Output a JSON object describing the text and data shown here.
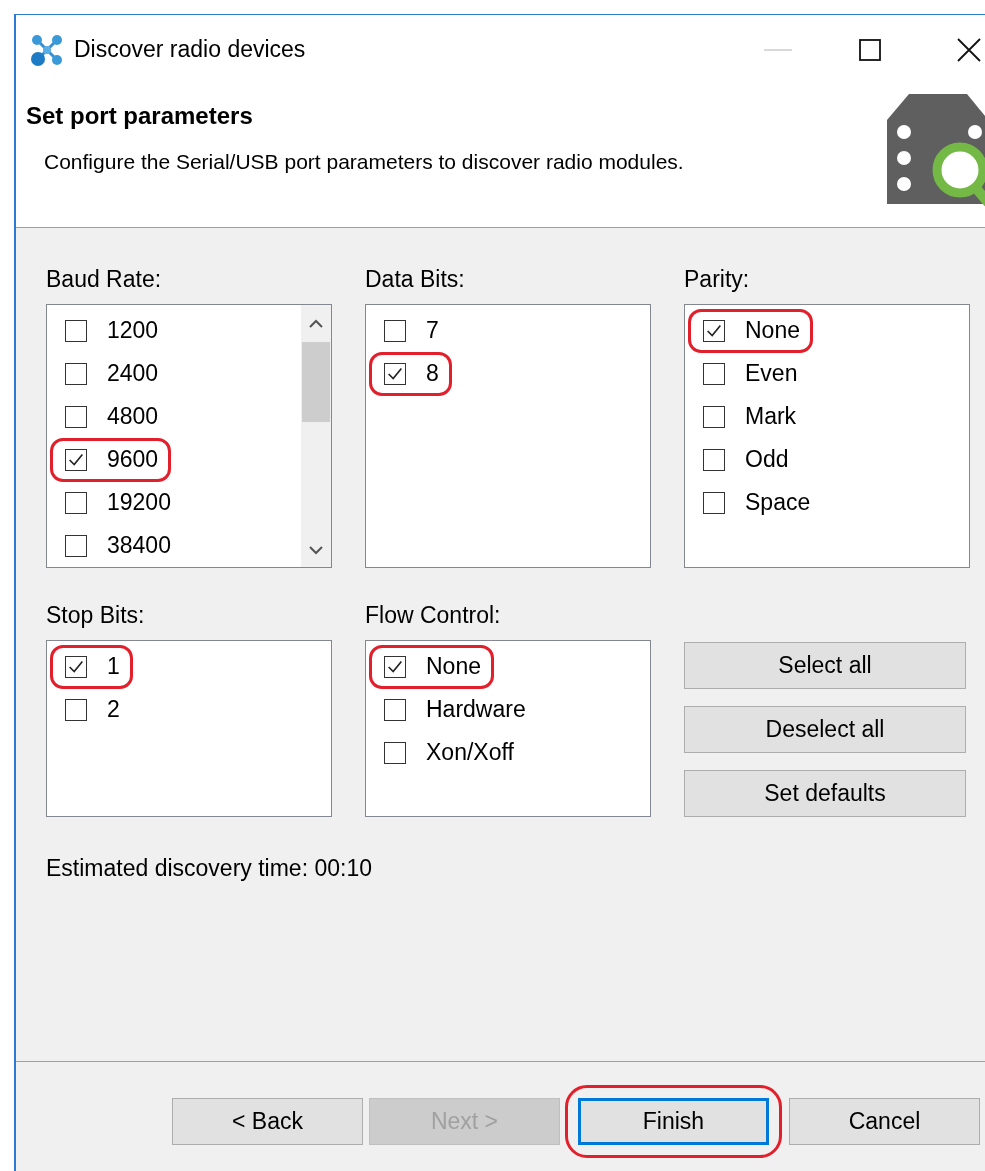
{
  "window": {
    "title": "Discover radio devices"
  },
  "header": {
    "title": "Set port parameters",
    "description": "Configure the Serial/USB port parameters to discover radio modules."
  },
  "groups": [
    {
      "label": "Baud Rate:",
      "scrollable": true,
      "items": [
        {
          "label": "1200",
          "checked": false,
          "highlighted": false
        },
        {
          "label": "2400",
          "checked": false,
          "highlighted": false
        },
        {
          "label": "4800",
          "checked": false,
          "highlighted": false
        },
        {
          "label": "9600",
          "checked": true,
          "highlighted": true
        },
        {
          "label": "19200",
          "checked": false,
          "highlighted": false
        },
        {
          "label": "38400",
          "checked": false,
          "highlighted": false
        }
      ]
    },
    {
      "label": "Data Bits:",
      "scrollable": false,
      "items": [
        {
          "label": "7",
          "checked": false,
          "highlighted": false
        },
        {
          "label": "8",
          "checked": true,
          "highlighted": true
        }
      ]
    },
    {
      "label": "Parity:",
      "scrollable": false,
      "items": [
        {
          "label": "None",
          "checked": true,
          "highlighted": true
        },
        {
          "label": "Even",
          "checked": false,
          "highlighted": false
        },
        {
          "label": "Mark",
          "checked": false,
          "highlighted": false
        },
        {
          "label": "Odd",
          "checked": false,
          "highlighted": false
        },
        {
          "label": "Space",
          "checked": false,
          "highlighted": false
        }
      ]
    },
    {
      "label": "Stop Bits:",
      "scrollable": false,
      "items": [
        {
          "label": "1",
          "checked": true,
          "highlighted": true
        },
        {
          "label": "2",
          "checked": false,
          "highlighted": false
        }
      ]
    },
    {
      "label": "Flow Control:",
      "scrollable": false,
      "items": [
        {
          "label": "None",
          "checked": true,
          "highlighted": true
        },
        {
          "label": "Hardware",
          "checked": false,
          "highlighted": false
        },
        {
          "label": "Xon/Xoff",
          "checked": false,
          "highlighted": false
        }
      ]
    }
  ],
  "side_buttons": [
    "Select all",
    "Deselect all",
    "Set defaults"
  ],
  "estimate": "Estimated discovery time: 00:10",
  "footer_buttons": [
    {
      "label": "< Back",
      "disabled": false,
      "default": false,
      "highlighted": false
    },
    {
      "label": "Next >",
      "disabled": true,
      "default": false,
      "highlighted": false
    },
    {
      "label": "Finish",
      "disabled": false,
      "default": true,
      "highlighted": true
    },
    {
      "label": "Cancel",
      "disabled": false,
      "default": false,
      "highlighted": false
    }
  ]
}
